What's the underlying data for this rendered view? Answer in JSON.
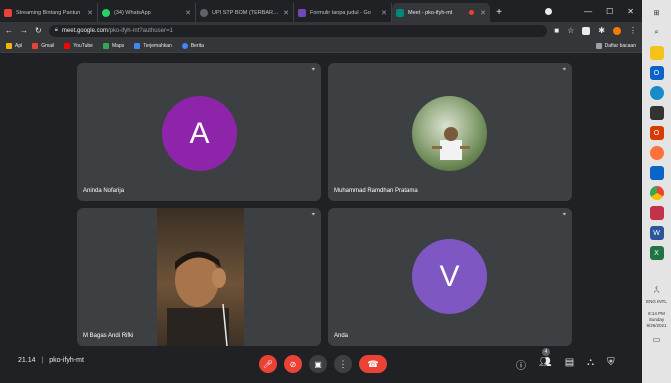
{
  "tabs": [
    {
      "label": "Streaming Bintang Pantun",
      "color": "#ea4335"
    },
    {
      "label": "(34) WhatsApp",
      "color": "#25d366"
    },
    {
      "label": "UPI STP BOM (TERBARU) p",
      "color": "#5f6368"
    },
    {
      "label": "Formulir tanpa judul - Go",
      "color": "#7248b9"
    },
    {
      "label": "Meet - pko-ifyh-mt",
      "color": "#00897b"
    }
  ],
  "address": {
    "host": "meet.google.com",
    "path": "/pko-ifyh-mt?authuser=1"
  },
  "bookmarks": [
    {
      "label": "Apl",
      "color": "#f4b400"
    },
    {
      "label": "Gmail",
      "color": "#ea4335"
    },
    {
      "label": "YouTube",
      "color": "#ff0000"
    },
    {
      "label": "Maps",
      "color": "#34a853"
    },
    {
      "label": "Terjemahkan",
      "color": "#4285f4"
    },
    {
      "label": "Berita",
      "color": "#4285f4"
    }
  ],
  "bookmarks_right": "Daftar bacaan",
  "participants": [
    {
      "name": "Aninda Nofarija",
      "initial": "A",
      "avatar_color": "#8e24aa"
    },
    {
      "name": "Muhammad Ramdhan Pratama",
      "initial": "",
      "avatar_color": "#7a9a6a"
    },
    {
      "name": "M Bagas Andi Rifki",
      "initial": "",
      "avatar_color": "#6b4a2e"
    },
    {
      "name": "Anda",
      "initial": "V",
      "avatar_color": "#7e57c2"
    }
  ],
  "meeting": {
    "time": "21.14",
    "code": "pko-ifyh-mt"
  },
  "colors": {
    "end_call": "#ea4335",
    "mic_off": "#ea4335"
  },
  "tray": {
    "clock": "8:14 PM",
    "day": "Sunday",
    "date": "9/26/2021",
    "lang": "ENG INTL"
  }
}
